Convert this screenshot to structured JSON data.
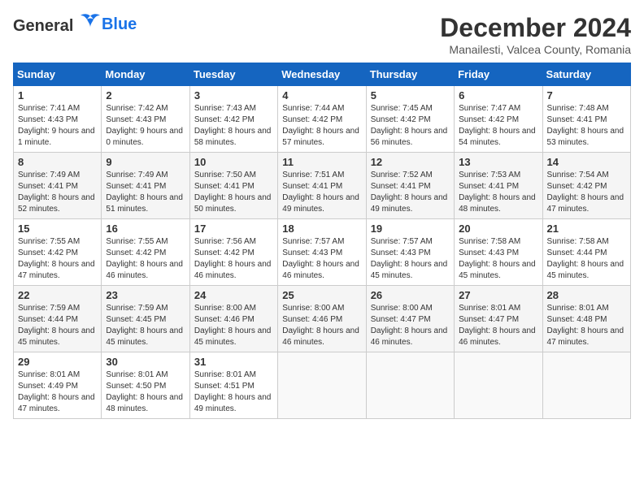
{
  "header": {
    "logo_general": "General",
    "logo_blue": "Blue",
    "month": "December 2024",
    "location": "Manailesti, Valcea County, Romania"
  },
  "weekdays": [
    "Sunday",
    "Monday",
    "Tuesday",
    "Wednesday",
    "Thursday",
    "Friday",
    "Saturday"
  ],
  "weeks": [
    [
      {
        "day": "1",
        "sunrise": "Sunrise: 7:41 AM",
        "sunset": "Sunset: 4:43 PM",
        "daylight": "Daylight: 9 hours and 1 minute."
      },
      {
        "day": "2",
        "sunrise": "Sunrise: 7:42 AM",
        "sunset": "Sunset: 4:43 PM",
        "daylight": "Daylight: 9 hours and 0 minutes."
      },
      {
        "day": "3",
        "sunrise": "Sunrise: 7:43 AM",
        "sunset": "Sunset: 4:42 PM",
        "daylight": "Daylight: 8 hours and 58 minutes."
      },
      {
        "day": "4",
        "sunrise": "Sunrise: 7:44 AM",
        "sunset": "Sunset: 4:42 PM",
        "daylight": "Daylight: 8 hours and 57 minutes."
      },
      {
        "day": "5",
        "sunrise": "Sunrise: 7:45 AM",
        "sunset": "Sunset: 4:42 PM",
        "daylight": "Daylight: 8 hours and 56 minutes."
      },
      {
        "day": "6",
        "sunrise": "Sunrise: 7:47 AM",
        "sunset": "Sunset: 4:42 PM",
        "daylight": "Daylight: 8 hours and 54 minutes."
      },
      {
        "day": "7",
        "sunrise": "Sunrise: 7:48 AM",
        "sunset": "Sunset: 4:41 PM",
        "daylight": "Daylight: 8 hours and 53 minutes."
      }
    ],
    [
      {
        "day": "8",
        "sunrise": "Sunrise: 7:49 AM",
        "sunset": "Sunset: 4:41 PM",
        "daylight": "Daylight: 8 hours and 52 minutes."
      },
      {
        "day": "9",
        "sunrise": "Sunrise: 7:49 AM",
        "sunset": "Sunset: 4:41 PM",
        "daylight": "Daylight: 8 hours and 51 minutes."
      },
      {
        "day": "10",
        "sunrise": "Sunrise: 7:50 AM",
        "sunset": "Sunset: 4:41 PM",
        "daylight": "Daylight: 8 hours and 50 minutes."
      },
      {
        "day": "11",
        "sunrise": "Sunrise: 7:51 AM",
        "sunset": "Sunset: 4:41 PM",
        "daylight": "Daylight: 8 hours and 49 minutes."
      },
      {
        "day": "12",
        "sunrise": "Sunrise: 7:52 AM",
        "sunset": "Sunset: 4:41 PM",
        "daylight": "Daylight: 8 hours and 49 minutes."
      },
      {
        "day": "13",
        "sunrise": "Sunrise: 7:53 AM",
        "sunset": "Sunset: 4:41 PM",
        "daylight": "Daylight: 8 hours and 48 minutes."
      },
      {
        "day": "14",
        "sunrise": "Sunrise: 7:54 AM",
        "sunset": "Sunset: 4:42 PM",
        "daylight": "Daylight: 8 hours and 47 minutes."
      }
    ],
    [
      {
        "day": "15",
        "sunrise": "Sunrise: 7:55 AM",
        "sunset": "Sunset: 4:42 PM",
        "daylight": "Daylight: 8 hours and 47 minutes."
      },
      {
        "day": "16",
        "sunrise": "Sunrise: 7:55 AM",
        "sunset": "Sunset: 4:42 PM",
        "daylight": "Daylight: 8 hours and 46 minutes."
      },
      {
        "day": "17",
        "sunrise": "Sunrise: 7:56 AM",
        "sunset": "Sunset: 4:42 PM",
        "daylight": "Daylight: 8 hours and 46 minutes."
      },
      {
        "day": "18",
        "sunrise": "Sunrise: 7:57 AM",
        "sunset": "Sunset: 4:43 PM",
        "daylight": "Daylight: 8 hours and 46 minutes."
      },
      {
        "day": "19",
        "sunrise": "Sunrise: 7:57 AM",
        "sunset": "Sunset: 4:43 PM",
        "daylight": "Daylight: 8 hours and 45 minutes."
      },
      {
        "day": "20",
        "sunrise": "Sunrise: 7:58 AM",
        "sunset": "Sunset: 4:43 PM",
        "daylight": "Daylight: 8 hours and 45 minutes."
      },
      {
        "day": "21",
        "sunrise": "Sunrise: 7:58 AM",
        "sunset": "Sunset: 4:44 PM",
        "daylight": "Daylight: 8 hours and 45 minutes."
      }
    ],
    [
      {
        "day": "22",
        "sunrise": "Sunrise: 7:59 AM",
        "sunset": "Sunset: 4:44 PM",
        "daylight": "Daylight: 8 hours and 45 minutes."
      },
      {
        "day": "23",
        "sunrise": "Sunrise: 7:59 AM",
        "sunset": "Sunset: 4:45 PM",
        "daylight": "Daylight: 8 hours and 45 minutes."
      },
      {
        "day": "24",
        "sunrise": "Sunrise: 8:00 AM",
        "sunset": "Sunset: 4:46 PM",
        "daylight": "Daylight: 8 hours and 45 minutes."
      },
      {
        "day": "25",
        "sunrise": "Sunrise: 8:00 AM",
        "sunset": "Sunset: 4:46 PM",
        "daylight": "Daylight: 8 hours and 46 minutes."
      },
      {
        "day": "26",
        "sunrise": "Sunrise: 8:00 AM",
        "sunset": "Sunset: 4:47 PM",
        "daylight": "Daylight: 8 hours and 46 minutes."
      },
      {
        "day": "27",
        "sunrise": "Sunrise: 8:01 AM",
        "sunset": "Sunset: 4:47 PM",
        "daylight": "Daylight: 8 hours and 46 minutes."
      },
      {
        "day": "28",
        "sunrise": "Sunrise: 8:01 AM",
        "sunset": "Sunset: 4:48 PM",
        "daylight": "Daylight: 8 hours and 47 minutes."
      }
    ],
    [
      {
        "day": "29",
        "sunrise": "Sunrise: 8:01 AM",
        "sunset": "Sunset: 4:49 PM",
        "daylight": "Daylight: 8 hours and 47 minutes."
      },
      {
        "day": "30",
        "sunrise": "Sunrise: 8:01 AM",
        "sunset": "Sunset: 4:50 PM",
        "daylight": "Daylight: 8 hours and 48 minutes."
      },
      {
        "day": "31",
        "sunrise": "Sunrise: 8:01 AM",
        "sunset": "Sunset: 4:51 PM",
        "daylight": "Daylight: 8 hours and 49 minutes."
      },
      null,
      null,
      null,
      null
    ]
  ]
}
